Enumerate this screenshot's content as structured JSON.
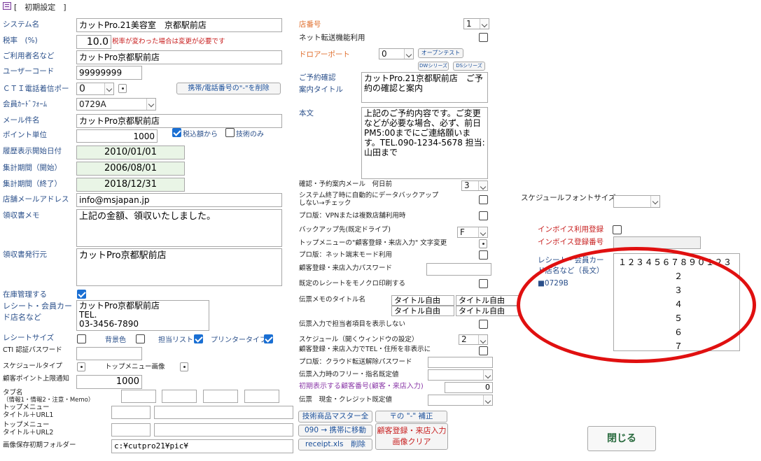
{
  "window": {
    "title": "[　初期設定　]"
  },
  "left": {
    "system_name": {
      "label": "システム名",
      "value": "カットPro.21美容室　京都駅前店"
    },
    "tax": {
      "label": "税率　(%)",
      "value": "10.0",
      "note": "税率が変わった場合は変更が必要です"
    },
    "user_name": {
      "label": "ご利用者名など",
      "value": "カットPro京都駅前店"
    },
    "user_code": {
      "label": "ユーザーコード",
      "value": "99999999"
    },
    "cti_port": {
      "label": "ＣＴＩ電話着信ポー",
      "value": "0",
      "button": "携帯/電話番号の\"-\"を削除"
    },
    "member_card": {
      "label": "会員ｶｰﾄﾞﾌｫｰﾑ",
      "value": "0729A"
    },
    "mail_subject": {
      "label": "メール件名",
      "value": "カットPro京都駅前店"
    },
    "point_unit": {
      "label": "ポイント単位",
      "value": "1000",
      "tax_in": "税込額から",
      "tech_only": "技術のみ"
    },
    "history_start": {
      "label": "履歴表示開始日付",
      "value": "2010/01/01"
    },
    "period_start": {
      "label": "集計期間（開始）",
      "value": "2006/08/01"
    },
    "period_end": {
      "label": "集計期間（終了）",
      "value": "2018/12/31"
    },
    "shop_mail": {
      "label": "店舗メールアドレス",
      "value": "info@msjapan.jp"
    },
    "receipt_memo": {
      "label": "領収書メモ",
      "value": "上記の金額、領収いたしました。"
    },
    "receipt_issuer": {
      "label": "領収書発行元",
      "value": "カットPro京都駅前店"
    },
    "stock": {
      "label": "在庫管理する"
    },
    "receipt_shop": {
      "label1": "レシート・会員カー",
      "label2": "ド店名など",
      "value": "カットPro京都駅前店\nTEL.\n03-3456-7890"
    },
    "receipt_size": {
      "label": "レシートサイズ",
      "bg_color": "背景色",
      "staff_list": "担当リスト",
      "printer_type": "プリンタータイプ"
    },
    "cti_pass": {
      "label": "CTI 認証パスワード"
    },
    "schedule_type": {
      "label": "スケジュールタイプ",
      "top_image": "トップメニュー画像"
    },
    "point_limit": {
      "label": "顧客ポイント上限通知",
      "value": "1000"
    },
    "tab_name": {
      "label1": "タブ名",
      "label2": "（情報1・情報2・注意・Memo）"
    },
    "top_menu1": {
      "label1": "トップメニュー",
      "label2": "タイトル＋URL1"
    },
    "top_menu2": {
      "label1": "トップメニュー",
      "label2": "タイトル＋URL2"
    },
    "image_folder": {
      "label": "画像保存初期フォルダー",
      "value": "c:¥cutpro21¥pic¥"
    }
  },
  "mid": {
    "shop_no": {
      "label": "店番号",
      "value": "1"
    },
    "net_transfer": {
      "label": "ネット転送機能利用"
    },
    "door_port": {
      "label": "ドロアーポート",
      "value": "0",
      "open_test": "オープンテスト",
      "dw": "DWシリーズ",
      "ds": "DSシリーズ"
    },
    "reserve_confirm": {
      "label1": "ご予約確認",
      "label2": "案内タイトル",
      "value": "カットPro.21京都駅前店　ご予約の確認と案内"
    },
    "body": {
      "label": "本文",
      "value": "上記のご予約内容です。ご変更などが必要な場合、必ず、前日PM5:00までにご連絡願います。TEL.090-1234-5678 担当:山田まで"
    },
    "confirm_days": {
      "label": "確認・予約案内メール　何日前",
      "value": "3"
    },
    "auto_backup": {
      "label1": "システム終了時に自動的にデータバックアップ",
      "label2": "しない→チェック"
    },
    "vpn": {
      "label": "プロ版：VPNまたは複数店舗利用時"
    },
    "backup_drive": {
      "label": "バックアップ先(既定ドライブ)",
      "value": "F"
    },
    "top_menu_text": {
      "label": "トップメニューの\"顧客登録・来店入力\" 文字変更"
    },
    "net_terminal": {
      "label": "プロ版：ネット端末モード利用"
    },
    "reg_password": {
      "label": "顧客登録・来店入力パスワード"
    },
    "mono_receipt": {
      "label": "既定のレシートをモノクロ印刷する"
    },
    "slip_memo": {
      "label": "伝票メモのタイトル名",
      "titles": [
        "タイトル自由",
        "タイトル自由",
        "タイトル自由",
        "タイトル自由"
      ]
    },
    "hide_staff": {
      "label": "伝票入力で担当者項目を表示しない"
    },
    "schedule_window": {
      "label": "スケジュール（開くウィンドウの設定）",
      "value": "2"
    },
    "hide_tel": {
      "label": "顧客登録・来店入力でTEL・住所を非表示に"
    },
    "cloud_pass": {
      "label": "プロ版：クラウド転送解除パスワード"
    },
    "free_nominate": {
      "label": "伝票入力時のフリー・指名既定値"
    },
    "initial_customer": {
      "label": "初期表示する顧客番号(顧客・来店入力)",
      "value": "0"
    },
    "cash_credit": {
      "label": "伝票　現金・クレジット既定値"
    },
    "buttons": {
      "tech_master": "技術商品マスター全",
      "postal_hyphen": "〒の \"-\" 補正",
      "move_090": "090 → 携帯に移動",
      "receipt_xls": "receipt.xls　削除",
      "customer_clear1": "顧客登録・来店入力",
      "customer_clear2": "画像クリア"
    }
  },
  "right": {
    "schedule_font": {
      "label": "スケジュールフォントサイズ"
    },
    "invoice_use": {
      "label": "インボイス利用登録"
    },
    "invoice_no": {
      "label": "インボイス登録番号"
    },
    "receipt_long": {
      "label1": "レシート・会員カー",
      "label2": "ド店名など（長文）",
      "template": "■0729B",
      "lines": [
        "１２３４５６７８９０１２３",
        "２",
        "３",
        "４",
        "５",
        "６",
        "７"
      ]
    },
    "close_button": "閉じる"
  },
  "accent": {
    "red_circle": "#e01010",
    "blue": "#1a6fd3",
    "label_blue": "#2a4f8a"
  }
}
